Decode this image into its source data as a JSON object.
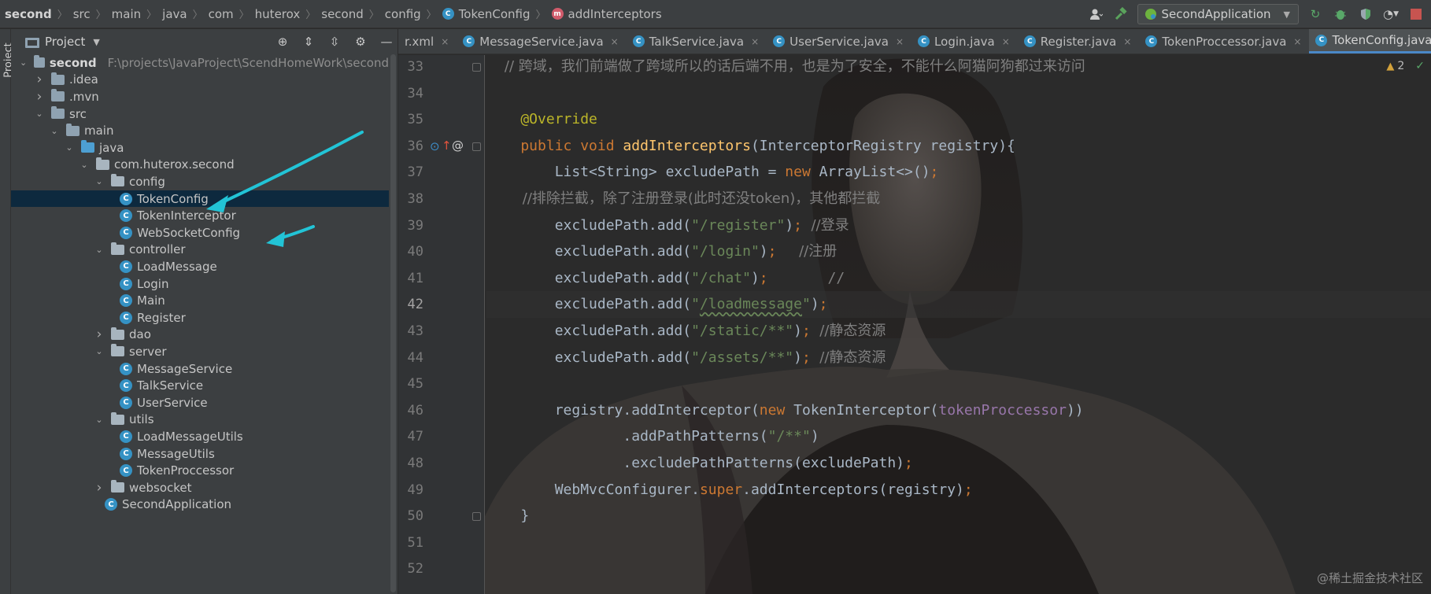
{
  "breadcrumb": [
    {
      "label": "second",
      "icon": null
    },
    {
      "label": "src",
      "icon": null
    },
    {
      "label": "main",
      "icon": null
    },
    {
      "label": "java",
      "icon": null
    },
    {
      "label": "com",
      "icon": null
    },
    {
      "label": "huterox",
      "icon": null
    },
    {
      "label": "second",
      "icon": null
    },
    {
      "label": "config",
      "icon": null
    },
    {
      "label": "TokenConfig",
      "icon": "class-icon"
    },
    {
      "label": "addInterceptors",
      "icon": "method-icon"
    }
  ],
  "class_badge": "C",
  "method_badge": "m",
  "run_config": {
    "label": "SecondApplication"
  },
  "sidebar_stripe_label": "Project",
  "project_panel": {
    "title": "Project",
    "tree": [
      {
        "label": "second",
        "path": "F:\\projects\\JavaProject\\ScendHomeWork\\second",
        "type": "module",
        "expanded": true,
        "depth": 0
      },
      {
        "label": ".idea",
        "type": "folder",
        "expanded": false,
        "depth": 1
      },
      {
        "label": ".mvn",
        "type": "folder",
        "expanded": false,
        "depth": 1
      },
      {
        "label": "src",
        "type": "folder",
        "expanded": true,
        "depth": 1
      },
      {
        "label": "main",
        "type": "folder",
        "expanded": true,
        "depth": 2
      },
      {
        "label": "java",
        "type": "source",
        "expanded": true,
        "depth": 3
      },
      {
        "label": "com.huterox.second",
        "type": "package",
        "expanded": true,
        "depth": 4
      },
      {
        "label": "config",
        "type": "package",
        "expanded": true,
        "depth": 5
      },
      {
        "label": "TokenConfig",
        "type": "class",
        "depth": 6,
        "selected": true
      },
      {
        "label": "TokenInterceptor",
        "type": "class",
        "depth": 6
      },
      {
        "label": "WebSocketConfig",
        "type": "class",
        "depth": 6
      },
      {
        "label": "controller",
        "type": "package",
        "expanded": true,
        "depth": 5
      },
      {
        "label": "LoadMessage",
        "type": "class",
        "depth": 6
      },
      {
        "label": "Login",
        "type": "class",
        "depth": 6
      },
      {
        "label": "Main",
        "type": "class",
        "depth": 6
      },
      {
        "label": "Register",
        "type": "class",
        "depth": 6
      },
      {
        "label": "dao",
        "type": "package",
        "expanded": false,
        "depth": 5
      },
      {
        "label": "server",
        "type": "package",
        "expanded": true,
        "depth": 5
      },
      {
        "label": "MessageService",
        "type": "class",
        "depth": 6
      },
      {
        "label": "TalkService",
        "type": "class",
        "depth": 6
      },
      {
        "label": "UserService",
        "type": "class",
        "depth": 6
      },
      {
        "label": "utils",
        "type": "package",
        "expanded": true,
        "depth": 5
      },
      {
        "label": "LoadMessageUtils",
        "type": "class",
        "depth": 6
      },
      {
        "label": "MessageUtils",
        "type": "class",
        "depth": 6
      },
      {
        "label": "TokenProccessor",
        "type": "class",
        "depth": 6
      },
      {
        "label": "websocket",
        "type": "package",
        "expanded": false,
        "depth": 5
      },
      {
        "label": "SecondApplication",
        "type": "class",
        "depth": 5
      }
    ]
  },
  "editor_tabs": [
    {
      "label": "r.xml",
      "icon": null,
      "active": false
    },
    {
      "label": "MessageService.java",
      "icon": "class-icon",
      "active": false
    },
    {
      "label": "TalkService.java",
      "icon": "class-icon",
      "active": false
    },
    {
      "label": "UserService.java",
      "icon": "class-icon",
      "active": false
    },
    {
      "label": "Login.java",
      "icon": "class-icon",
      "active": false
    },
    {
      "label": "Register.java",
      "icon": "class-icon",
      "active": false
    },
    {
      "label": "TokenProccessor.java",
      "icon": "class-icon",
      "active": false
    },
    {
      "label": "TokenConfig.java",
      "icon": "class-icon",
      "active": true
    }
  ],
  "editor": {
    "inspections": {
      "warnings": "2"
    },
    "current_line": "42",
    "lines": [
      {
        "no": "33",
        "tokens": [
          [
            "cm",
            "    // 跨域，我们前端做了跨域所以的话后端不用，也是为了安全，不能什么阿猫阿狗都过来访问"
          ]
        ]
      },
      {
        "no": "34",
        "tokens": []
      },
      {
        "no": "35",
        "tokens": [
          [
            "an",
            "    @Override"
          ]
        ]
      },
      {
        "no": "36",
        "tokens": [
          [
            "kw",
            "    public void "
          ],
          [
            "fn",
            "addInterceptors"
          ],
          [
            "",
            "(InterceptorRegistry registry){"
          ]
        ]
      },
      {
        "no": "37",
        "tokens": [
          [
            "",
            "        List<String> excludePath = "
          ],
          [
            "kw",
            "new "
          ],
          [
            "",
            "ArrayList<>()"
          ],
          [
            "kw",
            ";"
          ]
        ]
      },
      {
        "no": "38",
        "tokens": [
          [
            "cm",
            "        //排除拦截，除了注册登录(此时还没token)，其他都拦截"
          ]
        ]
      },
      {
        "no": "39",
        "tokens": [
          [
            "",
            "        excludePath.add("
          ],
          [
            "str",
            "\"/register\""
          ],
          [
            "",
            ")"
          ],
          [
            "kw",
            ";"
          ],
          [
            "cm",
            "  //登录"
          ]
        ]
      },
      {
        "no": "40",
        "tokens": [
          [
            "",
            "        excludePath.add("
          ],
          [
            "str",
            "\"/login\""
          ],
          [
            "",
            ")"
          ],
          [
            "kw",
            ";"
          ],
          [
            "cm",
            "     //注册"
          ]
        ]
      },
      {
        "no": "41",
        "tokens": [
          [
            "",
            "        excludePath.add("
          ],
          [
            "str",
            "\"/chat\""
          ],
          [
            "",
            ")"
          ],
          [
            "kw",
            ";"
          ],
          [
            "cm",
            "       //"
          ]
        ]
      },
      {
        "no": "42",
        "tokens": [
          [
            "",
            "        excludePath.add("
          ],
          [
            "str",
            "\""
          ],
          [
            "str sq",
            "/loadmessage"
          ],
          [
            "str",
            "\""
          ],
          [
            "",
            ")"
          ],
          [
            "kw",
            ";"
          ]
        ]
      },
      {
        "no": "43",
        "tokens": [
          [
            "",
            "        excludePath.add("
          ],
          [
            "str",
            "\"/static/**\""
          ],
          [
            "",
            ")"
          ],
          [
            "kw",
            ";"
          ],
          [
            "cm",
            "  //静态资源"
          ]
        ]
      },
      {
        "no": "44",
        "tokens": [
          [
            "",
            "        excludePath.add("
          ],
          [
            "str",
            "\"/assets/**\""
          ],
          [
            "",
            ")"
          ],
          [
            "kw",
            ";"
          ],
          [
            "cm",
            "  //静态资源"
          ]
        ]
      },
      {
        "no": "45",
        "tokens": []
      },
      {
        "no": "46",
        "tokens": [
          [
            "",
            "        registry.addInterceptor("
          ],
          [
            "kw",
            "new "
          ],
          [
            "",
            "TokenInterceptor("
          ],
          [
            "fld",
            "tokenProccessor"
          ],
          [
            "",
            "))"
          ]
        ]
      },
      {
        "no": "47",
        "tokens": [
          [
            "",
            "                .addPathPatterns("
          ],
          [
            "str",
            "\"/**\""
          ],
          [
            "",
            ")"
          ]
        ]
      },
      {
        "no": "48",
        "tokens": [
          [
            "",
            "                .excludePathPatterns(excludePath)"
          ],
          [
            "kw",
            ";"
          ]
        ]
      },
      {
        "no": "49",
        "tokens": [
          [
            "",
            "        WebMvcConfigurer."
          ],
          [
            "kw",
            "super"
          ],
          [
            "",
            ".addInterceptors(registry)"
          ],
          [
            "kw",
            ";"
          ]
        ]
      },
      {
        "no": "50",
        "tokens": [
          [
            "",
            "    }"
          ]
        ]
      },
      {
        "no": "51",
        "tokens": []
      },
      {
        "no": "52",
        "tokens": []
      }
    ]
  },
  "watermark": "@稀土掘金技术社区",
  "colors": {
    "accent": "#4a88c7",
    "selection": "#0d293e",
    "arrow": "#22c4d6",
    "class_icon": "#3592c4"
  }
}
